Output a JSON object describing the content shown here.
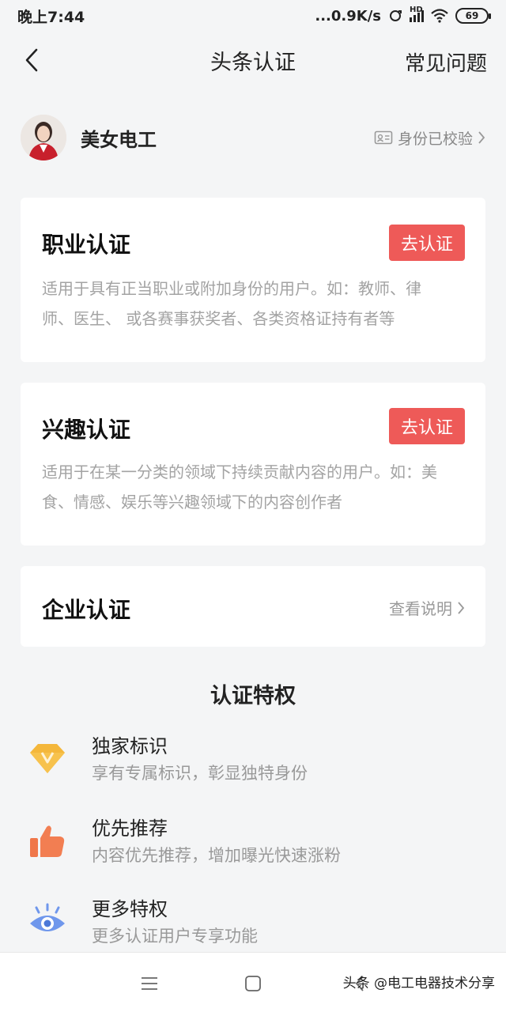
{
  "status_bar": {
    "time": "晚上7:44",
    "network_speed": "...0.9K/s",
    "hd": "HD",
    "battery": "69"
  },
  "nav": {
    "title": "头条认证",
    "faq": "常见问题"
  },
  "profile": {
    "name": "美女电工",
    "verified": "身份已校验"
  },
  "cards": {
    "professional": {
      "title": "职业认证",
      "button": "去认证",
      "desc_line1": "适用于具有正当职业或附加身份的用户。如：教师、律",
      "desc_line2": "师、医生、 或各赛事获奖者、各类资格证持有者等"
    },
    "interest": {
      "title": "兴趣认证",
      "button": "去认证",
      "desc_line1": "适用于在某一分类的领域下持续贡献内容的用户。如：美",
      "desc_line2": "食、情感、娱乐等兴趣领域下的内容创作者"
    },
    "enterprise": {
      "title": "企业认证",
      "link": "查看说明"
    }
  },
  "privileges": {
    "title": "认证特权",
    "items": [
      {
        "title": "独家标识",
        "desc": "享有专属标识，彰显独特身份",
        "icon": "diamond-v-icon"
      },
      {
        "title": "优先推荐",
        "desc": "内容优先推荐，增加曝光快速涨粉",
        "icon": "thumbs-up-icon"
      },
      {
        "title": "更多特权",
        "desc": "更多认证用户专享功能",
        "icon": "eye-icon"
      }
    ]
  },
  "watermark": "头条 @电工电器技术分享",
  "colors": {
    "accent": "#ee5a58",
    "background": "#f4f5f6",
    "diamond": "#f4b73b",
    "thumb": "#f0774a",
    "eye": "#6f97ec"
  }
}
